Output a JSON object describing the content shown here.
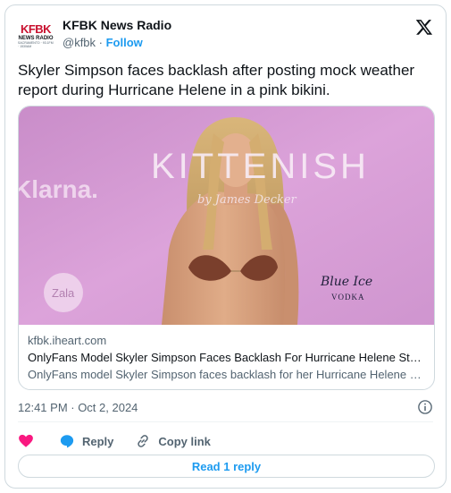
{
  "author": {
    "logo_line1": "KFBK",
    "logo_line2": "NEWS RADIO",
    "logo_line3": "SACRAMENTO · 93.1FM · 1530AM",
    "name": "KFBK News Radio",
    "handle": "@kfbk",
    "separator": " · ",
    "follow_label": "Follow"
  },
  "tweet": {
    "text": "Skyler Simpson faces backlash after posting mock weather report during Hurricane Helene in a pink bikini."
  },
  "card": {
    "image_text": {
      "brand_left": "Klarna.",
      "brand_center": "KITTENISH",
      "brand_center_sub": "by James Decker",
      "brand_zala": "Zala",
      "brand_blueice": "Blue Ice",
      "brand_blueice_sub": "VODKA"
    },
    "domain": "kfbk.iheart.com",
    "title": "OnlyFans Model Skyler Simpson Faces Backlash For Hurricane Helene Stunt | N...",
    "description": "OnlyFans model Skyler Simpson faces backlash for her Hurricane Helene stunt."
  },
  "meta": {
    "timestamp": "12:41 PM · Oct 2, 2024"
  },
  "actions": {
    "reply_label": "Reply",
    "copy_label": "Copy link",
    "read_replies_label": "Read 1 reply"
  },
  "colors": {
    "accent": "#1d9bf0",
    "heart": "#f91880",
    "reply_bubble": "#1d9bf0",
    "backdrop": "#d99ad8"
  }
}
